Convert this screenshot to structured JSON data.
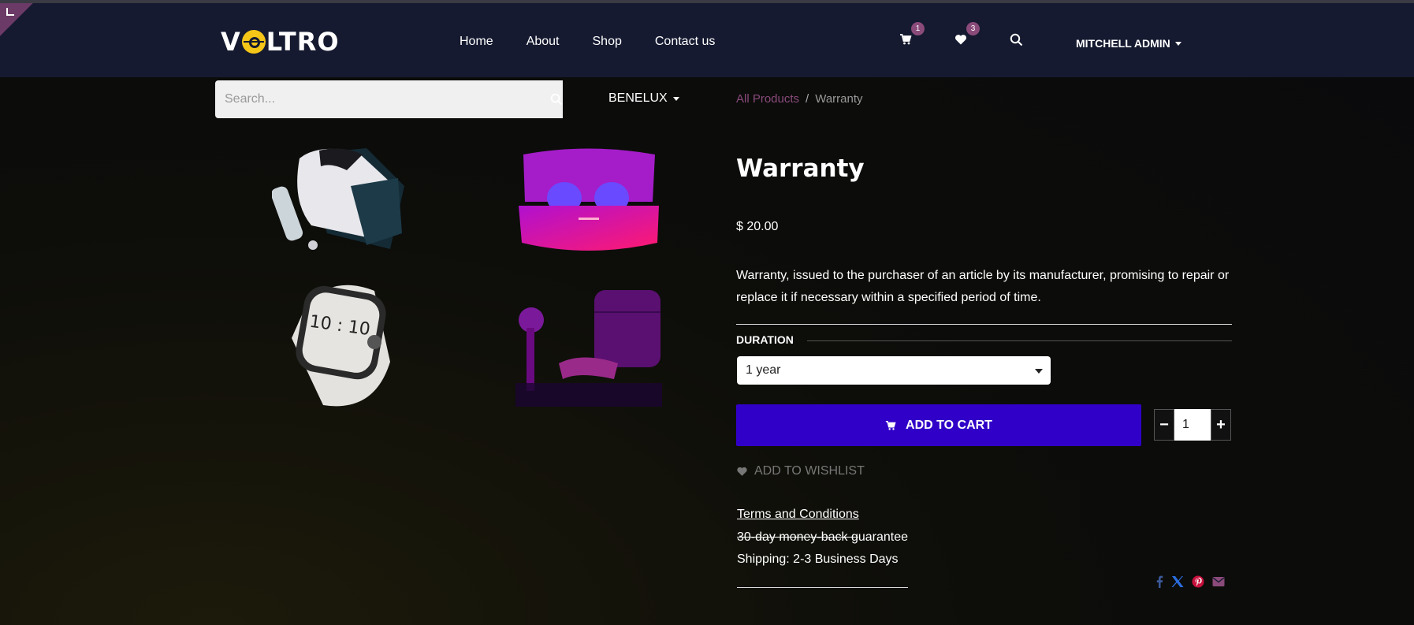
{
  "header": {
    "logo": {
      "prefix": "V",
      "suffix": "LTRO"
    },
    "nav": [
      {
        "label": "Home"
      },
      {
        "label": "About"
      },
      {
        "label": "Shop"
      },
      {
        "label": "Contact us"
      }
    ],
    "cart_count": "1",
    "wishlist_count": "3",
    "user_name": "MITCHELL ADMIN"
  },
  "search": {
    "placeholder": "Search..."
  },
  "pricelist": "BENELUX",
  "breadcrumb": {
    "parent": "All Products",
    "separator": "/",
    "current": "Warranty"
  },
  "product": {
    "name": "Warranty",
    "price": "$ 20.00",
    "description": "Warranty, issued to the purchaser of an article by its manufacturer, promising to repair or replace it if necessary within a specified period of time.",
    "attribute_label": "DURATION",
    "attribute_value": "1 year",
    "add_to_cart": "ADD TO CART",
    "quantity": "1",
    "add_to_wishlist": "ADD TO WISHLIST",
    "terms": "Terms and Conditions",
    "guarantee_struck": "30-day money-back g",
    "guarantee_rest": "uarantee",
    "shipping": "Shipping: 2-3 Business Days",
    "watch_time": "10 : 10"
  },
  "share_icons": [
    "facebook-icon",
    "x-icon",
    "pinterest-icon",
    "email-icon"
  ],
  "colors": {
    "header_bg": "#151a30",
    "accent": "#8a4a7a",
    "cta": "#3100c8",
    "logo_yellow": "#f5c518"
  }
}
